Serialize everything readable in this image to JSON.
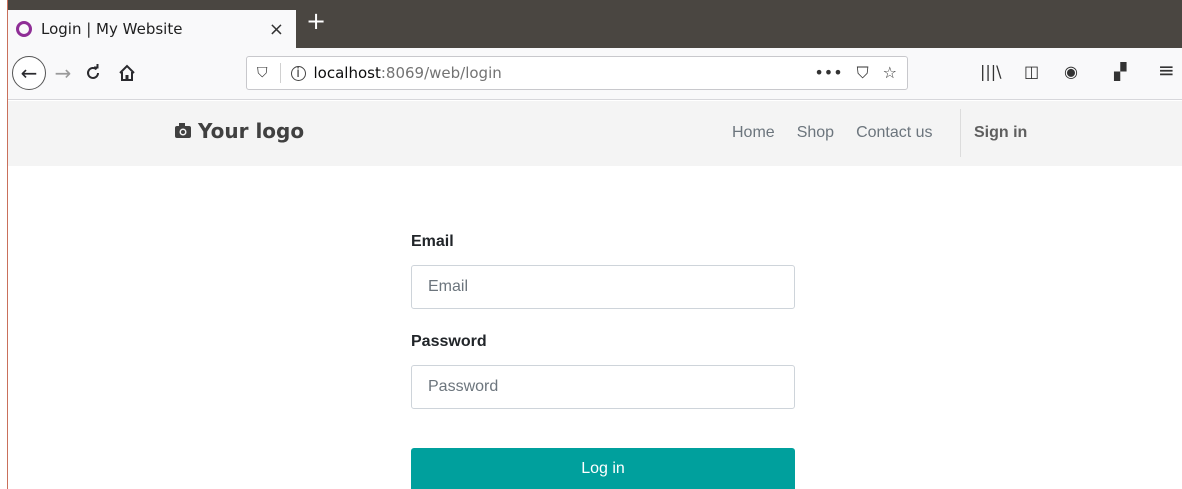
{
  "browser": {
    "tab_title": "Login | My Website",
    "tab_close": "×",
    "new_tab": "+",
    "url_host": "localhost",
    "url_rest": ":8069/web/login",
    "url_actions": [
      "•••",
      "⛉",
      "☆"
    ],
    "icons": {
      "back": "←",
      "forward": "→",
      "reload": "C",
      "home": "⌂",
      "shield": "⛉",
      "info": "i",
      "library": "|||\\",
      "sidebar": "◫",
      "account": "◉",
      "extension": "▞",
      "menu": "≡"
    }
  },
  "site": {
    "logo_text": "Your logo",
    "logo_icon": "📷",
    "nav": [
      "Home",
      "Shop",
      "Contact us"
    ],
    "signin": "Sign in"
  },
  "login": {
    "email_label": "Email",
    "email_placeholder": "Email",
    "password_label": "Password",
    "password_placeholder": "Password",
    "submit": "Log in"
  },
  "colors": {
    "primary": "#00a09d",
    "tabstrip": "#4a4641",
    "favicon": "#8f2e96"
  }
}
